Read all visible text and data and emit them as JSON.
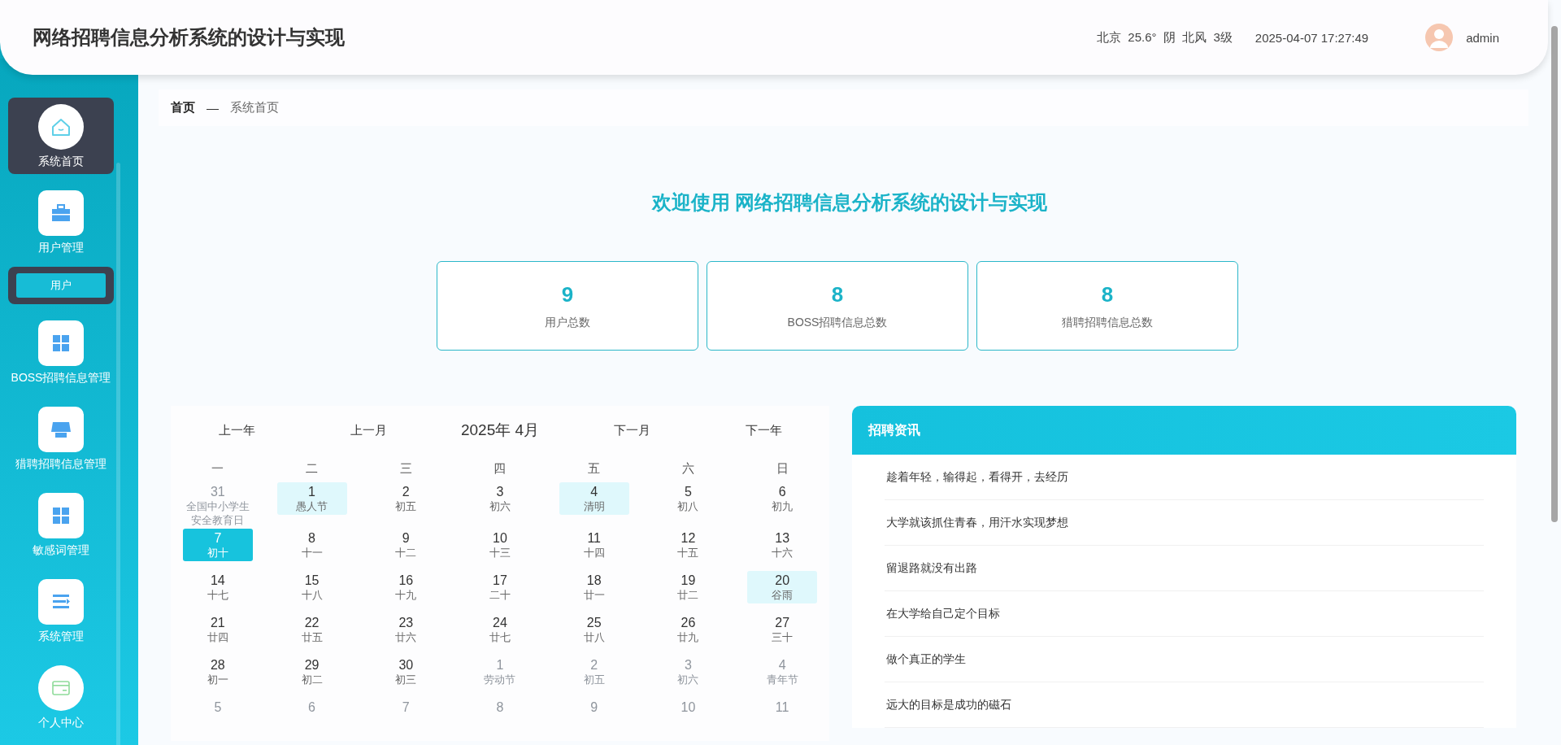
{
  "header": {
    "title": "网络招聘信息分析系统的设计与实现",
    "weather": "北京  25.6°  阴  北风  3级",
    "datetime": "2025-04-07 17:27:49",
    "user": "admin"
  },
  "sidebar": {
    "items": [
      {
        "label": "系统首页",
        "selected": true
      },
      {
        "label": "用户管理",
        "selected": false,
        "expanded": true,
        "children": [
          {
            "label": "用户"
          }
        ]
      },
      {
        "label": "BOSS招聘信息管理",
        "selected": false
      },
      {
        "label": "猎聘招聘信息管理",
        "selected": false
      },
      {
        "label": "敏感词管理",
        "selected": false
      },
      {
        "label": "系统管理",
        "selected": false
      },
      {
        "label": "个人中心",
        "selected": false
      }
    ]
  },
  "breadcrumb": {
    "home": "首页",
    "separator": "—",
    "current": "系统首页"
  },
  "welcome": "欢迎使用 网络招聘信息分析系统的设计与实现",
  "stats": [
    {
      "value": "9",
      "label": "用户总数"
    },
    {
      "value": "8",
      "label": "BOSS招聘信息总数"
    },
    {
      "value": "8",
      "label": "猎聘招聘信息总数"
    }
  ],
  "calendar": {
    "prev_year": "上一年",
    "prev_month": "上一月",
    "title": "2025年 4月",
    "next_month": "下一月",
    "next_year": "下一年",
    "weekdays": [
      "一",
      "二",
      "三",
      "四",
      "五",
      "六",
      "日"
    ],
    "weeks": [
      [
        {
          "day": "31",
          "lunar": "全国中小学生安全教育日",
          "in_month": false,
          "highlighted": false,
          "selected": false
        },
        {
          "day": "1",
          "lunar": "愚人节",
          "in_month": true,
          "highlighted": true,
          "selected": false
        },
        {
          "day": "2",
          "lunar": "初五",
          "in_month": true,
          "highlighted": false,
          "selected": false
        },
        {
          "day": "3",
          "lunar": "初六",
          "in_month": true,
          "highlighted": false,
          "selected": false
        },
        {
          "day": "4",
          "lunar": "清明",
          "in_month": true,
          "highlighted": true,
          "selected": false
        },
        {
          "day": "5",
          "lunar": "初八",
          "in_month": true,
          "highlighted": false,
          "selected": false
        },
        {
          "day": "6",
          "lunar": "初九",
          "in_month": true,
          "highlighted": false,
          "selected": false
        }
      ],
      [
        {
          "day": "7",
          "lunar": "初十",
          "in_month": true,
          "highlighted": false,
          "selected": true
        },
        {
          "day": "8",
          "lunar": "十一",
          "in_month": true,
          "highlighted": false,
          "selected": false
        },
        {
          "day": "9",
          "lunar": "十二",
          "in_month": true,
          "highlighted": false,
          "selected": false
        },
        {
          "day": "10",
          "lunar": "十三",
          "in_month": true,
          "highlighted": false,
          "selected": false
        },
        {
          "day": "11",
          "lunar": "十四",
          "in_month": true,
          "highlighted": false,
          "selected": false
        },
        {
          "day": "12",
          "lunar": "十五",
          "in_month": true,
          "highlighted": false,
          "selected": false
        },
        {
          "day": "13",
          "lunar": "十六",
          "in_month": true,
          "highlighted": false,
          "selected": false
        }
      ],
      [
        {
          "day": "14",
          "lunar": "十七",
          "in_month": true,
          "highlighted": false,
          "selected": false
        },
        {
          "day": "15",
          "lunar": "十八",
          "in_month": true,
          "highlighted": false,
          "selected": false
        },
        {
          "day": "16",
          "lunar": "十九",
          "in_month": true,
          "highlighted": false,
          "selected": false
        },
        {
          "day": "17",
          "lunar": "二十",
          "in_month": true,
          "highlighted": false,
          "selected": false
        },
        {
          "day": "18",
          "lunar": "廿一",
          "in_month": true,
          "highlighted": false,
          "selected": false
        },
        {
          "day": "19",
          "lunar": "廿二",
          "in_month": true,
          "highlighted": false,
          "selected": false
        },
        {
          "day": "20",
          "lunar": "谷雨",
          "in_month": true,
          "highlighted": true,
          "selected": false
        }
      ],
      [
        {
          "day": "21",
          "lunar": "廿四",
          "in_month": true,
          "highlighted": false,
          "selected": false
        },
        {
          "day": "22",
          "lunar": "廿五",
          "in_month": true,
          "highlighted": false,
          "selected": false
        },
        {
          "day": "23",
          "lunar": "廿六",
          "in_month": true,
          "highlighted": false,
          "selected": false
        },
        {
          "day": "24",
          "lunar": "廿七",
          "in_month": true,
          "highlighted": false,
          "selected": false
        },
        {
          "day": "25",
          "lunar": "廿八",
          "in_month": true,
          "highlighted": false,
          "selected": false
        },
        {
          "day": "26",
          "lunar": "廿九",
          "in_month": true,
          "highlighted": false,
          "selected": false
        },
        {
          "day": "27",
          "lunar": "三十",
          "in_month": true,
          "highlighted": false,
          "selected": false
        }
      ],
      [
        {
          "day": "28",
          "lunar": "初一",
          "in_month": true,
          "highlighted": false,
          "selected": false
        },
        {
          "day": "29",
          "lunar": "初二",
          "in_month": true,
          "highlighted": false,
          "selected": false
        },
        {
          "day": "30",
          "lunar": "初三",
          "in_month": true,
          "highlighted": false,
          "selected": false
        },
        {
          "day": "1",
          "lunar": "劳动节",
          "in_month": false,
          "highlighted": false,
          "selected": false
        },
        {
          "day": "2",
          "lunar": "初五",
          "in_month": false,
          "highlighted": false,
          "selected": false
        },
        {
          "day": "3",
          "lunar": "初六",
          "in_month": false,
          "highlighted": false,
          "selected": false
        },
        {
          "day": "4",
          "lunar": "青年节",
          "in_month": false,
          "highlighted": false,
          "selected": false
        }
      ],
      [
        {
          "day": "5",
          "in_month": false,
          "highlighted": false,
          "selected": false
        },
        {
          "day": "6",
          "in_month": false,
          "highlighted": false,
          "selected": false
        },
        {
          "day": "7",
          "in_month": false,
          "highlighted": false,
          "selected": false
        },
        {
          "day": "8",
          "in_month": false,
          "highlighted": false,
          "selected": false
        },
        {
          "day": "9",
          "in_month": false,
          "highlighted": false,
          "selected": false
        },
        {
          "day": "10",
          "in_month": false,
          "highlighted": false,
          "selected": false
        },
        {
          "day": "11",
          "in_month": false,
          "highlighted": false,
          "selected": false
        }
      ]
    ]
  },
  "news": {
    "title": "招聘资讯",
    "items": [
      "趁着年轻，输得起，看得开，去经历",
      "大学就该抓住青春，用汗水实现梦想",
      "留退路就没有出路",
      "在大学给自己定个目标",
      "做个真正的学生",
      "远大的目标是成功的磁石"
    ]
  }
}
